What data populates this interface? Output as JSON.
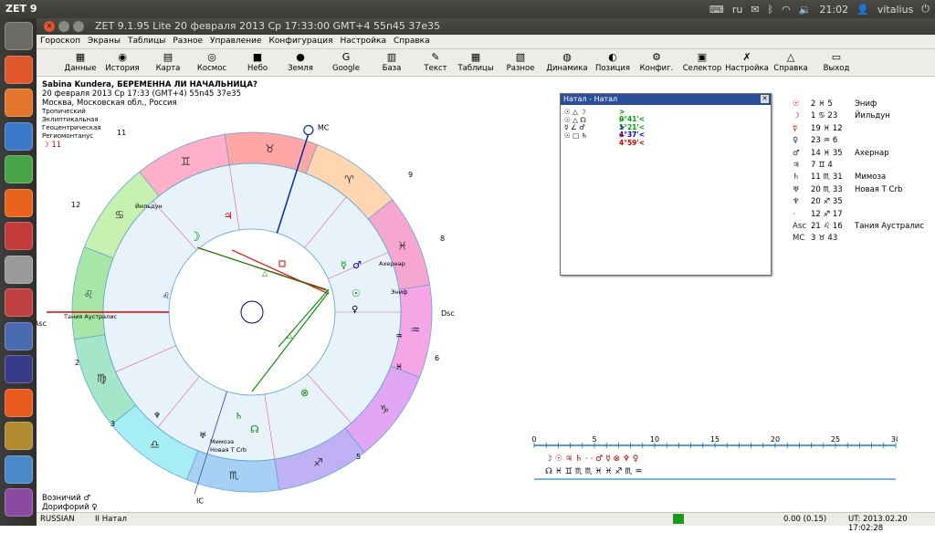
{
  "topbar": {
    "app": "ZET 9",
    "keyboard": "ru",
    "clock": "21:02",
    "user": "vitalius"
  },
  "window": {
    "title": "ZET 9.1.95 Lite   20 февраля 2013  Ср   17:33:00 GMT+4 55n45  37e35"
  },
  "menu": [
    "Гороскоп",
    "Экраны",
    "Таблицы",
    "Разное",
    "Управление",
    "Конфигурация",
    "Настройка",
    "Справка"
  ],
  "toolbar": [
    {
      "label": "Данные",
      "icon": "data-icon"
    },
    {
      "label": "История",
      "icon": "history-icon"
    },
    {
      "label": "Карта",
      "icon": "map-icon"
    },
    {
      "label": "Космос",
      "icon": "cosmos-icon"
    },
    {
      "label": "Небо",
      "icon": "sky-icon"
    },
    {
      "label": "Земля",
      "icon": "earth-icon"
    },
    {
      "label": "Google",
      "icon": "google-icon"
    },
    {
      "label": "База",
      "icon": "database-icon"
    },
    {
      "label": "Текст",
      "icon": "text-icon"
    },
    {
      "label": "Таблицы",
      "icon": "tables-icon"
    },
    {
      "label": "Разное",
      "icon": "misc-icon"
    },
    {
      "label": "Динамика",
      "icon": "dynamics-icon"
    },
    {
      "label": "Позиция",
      "icon": "position-icon"
    },
    {
      "label": "Конфиг.",
      "icon": "config-icon"
    },
    {
      "label": "Селектор",
      "icon": "selector-icon"
    },
    {
      "label": "Настройка",
      "icon": "settings-icon"
    },
    {
      "label": "Справка",
      "icon": "help-icon"
    },
    {
      "label": "Выход",
      "icon": "exit-icon"
    }
  ],
  "info": {
    "title": "Sabina Kundera, БЕРЕМЕННА ЛИ НАЧАЛЬНИЦА?",
    "date": "20 февраля 2013  Ср   17:33 (GMT+4) 55n45  37e35",
    "place": "Москва, Московская обл., Россия",
    "modes": [
      "Тропический",
      "Эклиптикальная",
      "Геоцентрическая",
      "Региомонтанус"
    ],
    "moon": "☽   11"
  },
  "chart": {
    "houses": [
      "1",
      "2",
      "3",
      "4",
      "5",
      "6",
      "7",
      "8",
      "9",
      "10",
      "11",
      "12"
    ],
    "labels": {
      "asc": "Asc",
      "dsc": "Dsc",
      "mc": "MC",
      "ic": "IC"
    },
    "house_numbers": [
      {
        "t": "11"
      },
      {
        "t": "12"
      },
      {
        "t": "2"
      },
      {
        "t": "3"
      },
      {
        "t": "5"
      },
      {
        "t": "6"
      },
      {
        "t": "8"
      },
      {
        "t": "9"
      }
    ],
    "stars": [
      "Йильдун",
      "Ахернар",
      "Эниф",
      "Тания Аустралис",
      "Мимоза",
      "Новая Т Crb"
    ]
  },
  "dialog": {
    "title": "Натал - Натал",
    "rows": [
      {
        "glyphs": "☉ △ ☽",
        "deg": ">  0°41'<",
        "color": "#00a000"
      },
      {
        "glyphs": "☉ △ ☊",
        "deg": ">  1°21'<",
        "color": "#00a000"
      },
      {
        "glyphs": "☿ ∠ ♂",
        "deg": ">  4°37'<",
        "color": "#0000c8"
      },
      {
        "glyphs": "☉ □ ♄",
        "deg": ">  4°59'<",
        "color": "#d00000"
      }
    ]
  },
  "planets": [
    {
      "g": "☉",
      "v": "2 ♓ 5",
      "n": "Эниф"
    },
    {
      "g": "☽",
      "v": "1 ♋ 23",
      "n": "Йильдун"
    },
    {
      "g": "☿",
      "v": "19 ♓ 12",
      "n": ""
    },
    {
      "g": "♀",
      "v": "23 ♒ 6",
      "n": ""
    },
    {
      "g": "♂",
      "v": "14 ♓ 35",
      "n": "Ахернар"
    },
    {
      "g": "♃",
      "v": "7 ♊ 4",
      "n": ""
    },
    {
      "g": "♄",
      "v": "11 ♏ 31",
      "n": "Мимоза"
    },
    {
      "g": "♅",
      "v": "20 ♏ 33",
      "n": "Новая Т Crb"
    },
    {
      "g": "♆",
      "v": "20 ♐ 35",
      "n": ""
    },
    {
      "g": "·",
      "v": "12 ♐ 17",
      "n": ""
    },
    {
      "g": "Asc",
      "v": "21 ♌ 16",
      "n": "Тания Аустралис"
    },
    {
      "g": "MC",
      "v": "3 ♉ 43",
      "n": ""
    }
  ],
  "bottom": {
    "l1": "Возничий  ♂",
    "l2": "Дорифорий  ♀"
  },
  "scale": {
    "ticks": [
      "0",
      "5",
      "10",
      "15",
      "20",
      "25",
      "30"
    ],
    "row1": "☽ ☉       ♃      ♄ ·  ·  ♂     ☿ ⊗ ♆  ♀",
    "row2": "☊ ♓        ♊      ♏ ♏   ♓     ♓ ♐ ♏  ♒"
  },
  "status": {
    "lang": "RUSSIAN",
    "mode": "II Натал",
    "val": "0.00 (0.15)",
    "utc": "UT: 2013.02.20 17:02:28"
  },
  "colors": {
    "ring": [
      "#a6d8a6",
      "#c9edb6",
      "#eef7a6",
      "#ffd7b3",
      "#ffb0b0",
      "#ff9dca",
      "#f4a6ee",
      "#d8a6f4",
      "#b8a6ee",
      "#a6c8f4",
      "#a6e6f4",
      "#a6f4e0"
    ]
  }
}
